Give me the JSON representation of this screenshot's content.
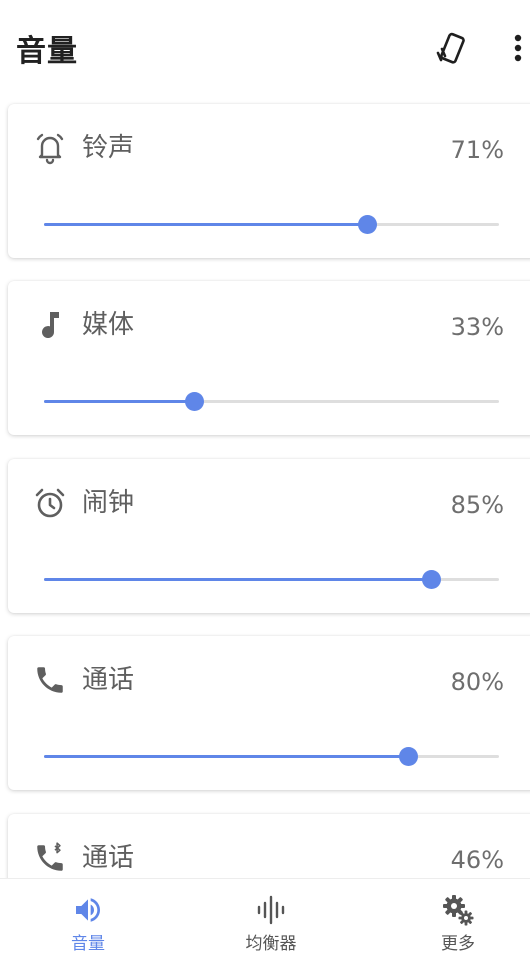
{
  "appbar": {
    "title": "音量",
    "actions": [
      {
        "name": "flip-phone-icon"
      },
      {
        "name": "more-vert-icon"
      }
    ]
  },
  "colors": {
    "accent": "#5f86e8",
    "track": "#dedede",
    "icon": "#5f5f5f"
  },
  "volumes": [
    {
      "icon": "bell-icon",
      "label": "铃声",
      "percent": "71%",
      "level": 0.71
    },
    {
      "icon": "music-note-icon",
      "label": "媒体",
      "percent": "33%",
      "level": 0.33
    },
    {
      "icon": "alarm-clock-icon",
      "label": "闹钟",
      "percent": "85%",
      "level": 0.85
    },
    {
      "icon": "phone-icon",
      "label": "通话",
      "percent": "80%",
      "level": 0.8
    },
    {
      "icon": "bluetooth-phone-icon",
      "label": "通话",
      "percent": "46%",
      "level": 0.46
    }
  ],
  "nav": [
    {
      "icon": "volume-icon",
      "label": "音量",
      "active": true
    },
    {
      "icon": "equalizer-icon",
      "label": "均衡器",
      "active": false
    },
    {
      "icon": "settings-gears-icon",
      "label": "更多",
      "active": false
    }
  ]
}
